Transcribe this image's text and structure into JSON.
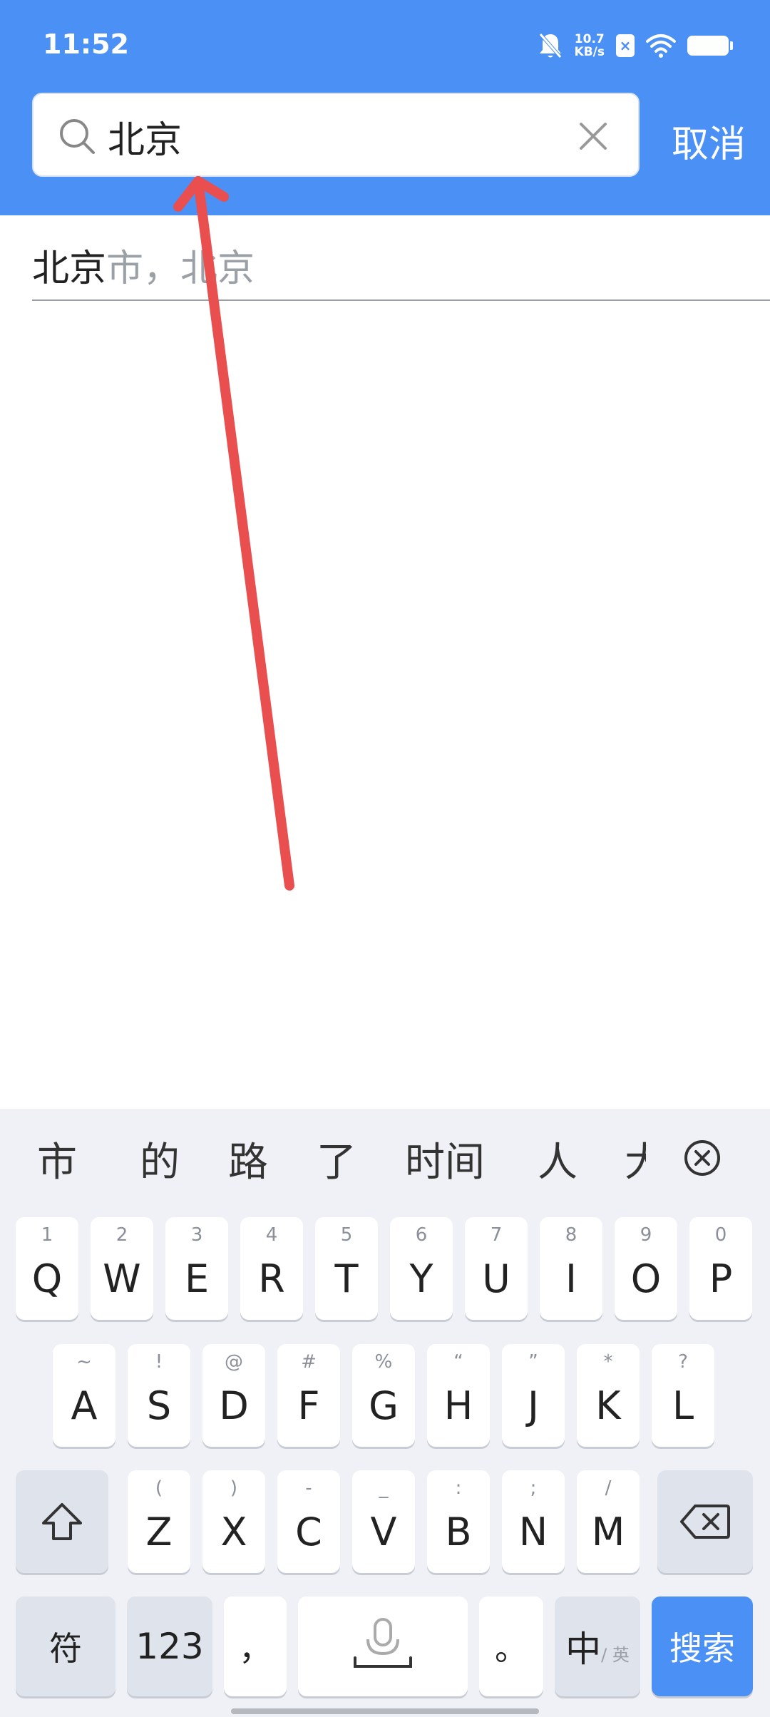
{
  "status_bar": {
    "time": "11:52",
    "net_speed_top": "10.7",
    "net_speed_bottom": "KB/s",
    "sim_label": "×"
  },
  "search": {
    "value": "北京",
    "placeholder": "",
    "cancel_label": "取消"
  },
  "suggestion": {
    "match": "北京",
    "rest": "市，北京"
  },
  "keyboard": {
    "candidates": [
      "市",
      "的",
      "路",
      "了",
      "时间",
      "人",
      "大"
    ],
    "row1": [
      {
        "sup": "1",
        "main": "Q"
      },
      {
        "sup": "2",
        "main": "W"
      },
      {
        "sup": "3",
        "main": "E"
      },
      {
        "sup": "4",
        "main": "R"
      },
      {
        "sup": "5",
        "main": "T"
      },
      {
        "sup": "6",
        "main": "Y"
      },
      {
        "sup": "7",
        "main": "U"
      },
      {
        "sup": "8",
        "main": "I"
      },
      {
        "sup": "9",
        "main": "O"
      },
      {
        "sup": "0",
        "main": "P"
      }
    ],
    "row2": [
      {
        "sup": "~",
        "main": "A"
      },
      {
        "sup": "!",
        "main": "S"
      },
      {
        "sup": "@",
        "main": "D"
      },
      {
        "sup": "#",
        "main": "F"
      },
      {
        "sup": "%",
        "main": "G"
      },
      {
        "sup": "“",
        "main": "H"
      },
      {
        "sup": "”",
        "main": "J"
      },
      {
        "sup": "*",
        "main": "K"
      },
      {
        "sup": "?",
        "main": "L"
      }
    ],
    "row3": [
      {
        "sup": "(",
        "main": "Z"
      },
      {
        "sup": ")",
        "main": "X"
      },
      {
        "sup": "-",
        "main": "C"
      },
      {
        "sup": "_",
        "main": "V"
      },
      {
        "sup": ":",
        "main": "B"
      },
      {
        "sup": ";",
        "main": "N"
      },
      {
        "sup": "/",
        "main": "M"
      }
    ],
    "symbol_label": "符",
    "numeric_label": "123",
    "comma_label": "，",
    "period_label": "。",
    "lang_main": "中",
    "lang_sub": "/ 英",
    "search_label": "搜索"
  },
  "colors": {
    "header": "#4a90f5",
    "keyboard_bg": "#eff1f6",
    "arrow": "#e94f4f"
  }
}
